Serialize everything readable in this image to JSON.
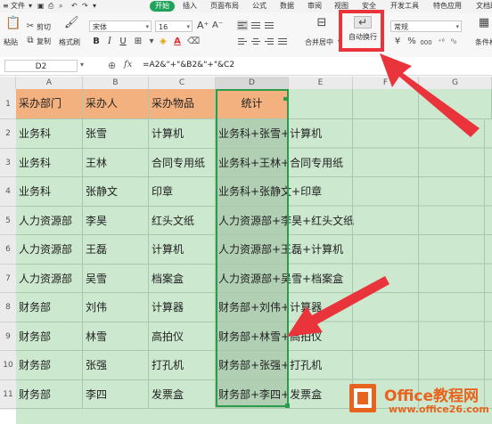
{
  "menu": {
    "file": "文件",
    "start": "开始",
    "items": [
      "插入",
      "页面布局",
      "公式",
      "数据",
      "审阅",
      "视图",
      "安全",
      "开发工具",
      "特色应用",
      "文档助手"
    ]
  },
  "ribbon": {
    "paste": "粘贴",
    "cut": "剪切",
    "copy": "复制",
    "format_painter": "格式刷",
    "font_name": "宋体",
    "font_size": "16",
    "bold": "B",
    "italic": "I",
    "underline": "U",
    "merge_center": "合并居中",
    "auto_wrap": "自动换行",
    "number_format": "常规",
    "percent": "%",
    "thousands": "000",
    "cond_format": "条件格式",
    "accent_color": "#20a35a",
    "highlight_color": "#e8343a"
  },
  "formula_bar": {
    "name_box": "D2",
    "fx": "fx",
    "formula": "=A2&\"+\"&B2&\"+\"&C2"
  },
  "grid": {
    "columns": [
      "A",
      "B",
      "C",
      "D",
      "E",
      "F",
      "G"
    ],
    "rows": [
      "1",
      "2",
      "3",
      "4",
      "5",
      "6",
      "7",
      "8",
      "9",
      "10",
      "11"
    ],
    "headers": [
      "采办部门",
      "采办人",
      "采办物品",
      "统计"
    ],
    "data": [
      [
        "业务科",
        "张雪",
        "计算机",
        "业务科+张雪+计算机"
      ],
      [
        "业务科",
        "王林",
        "合同专用纸",
        "业务科+王林+合同专用纸"
      ],
      [
        "业务科",
        "张静文",
        "印章",
        "业务科+张静文+印章"
      ],
      [
        "人力资源部",
        "李昊",
        "红头文纸",
        "人力资源部+李昊+红头文纸"
      ],
      [
        "人力资源部",
        "王磊",
        "计算机",
        "人力资源部+王磊+计算机"
      ],
      [
        "人力资源部",
        "吴雪",
        "档案盒",
        "人力资源部+吴雪+档案盒"
      ],
      [
        "财务部",
        "刘伟",
        "计算器",
        "财务部+刘伟+计算器"
      ],
      [
        "财务部",
        "林雪",
        "高拍仪",
        "财务部+林雪+高拍仪"
      ],
      [
        "财务部",
        "张强",
        "打孔机",
        "财务部+张强+打孔机"
      ],
      [
        "财务部",
        "李四",
        "发票盒",
        "财务部+李四+发票盒"
      ]
    ],
    "header_fill": "#f3b17f",
    "sheet_fill": "#cce8cf",
    "selection_color": "#2c9b4c"
  },
  "watermark": {
    "title": "Office教程网",
    "url": "www.office26.com",
    "color": "#e8641e"
  }
}
